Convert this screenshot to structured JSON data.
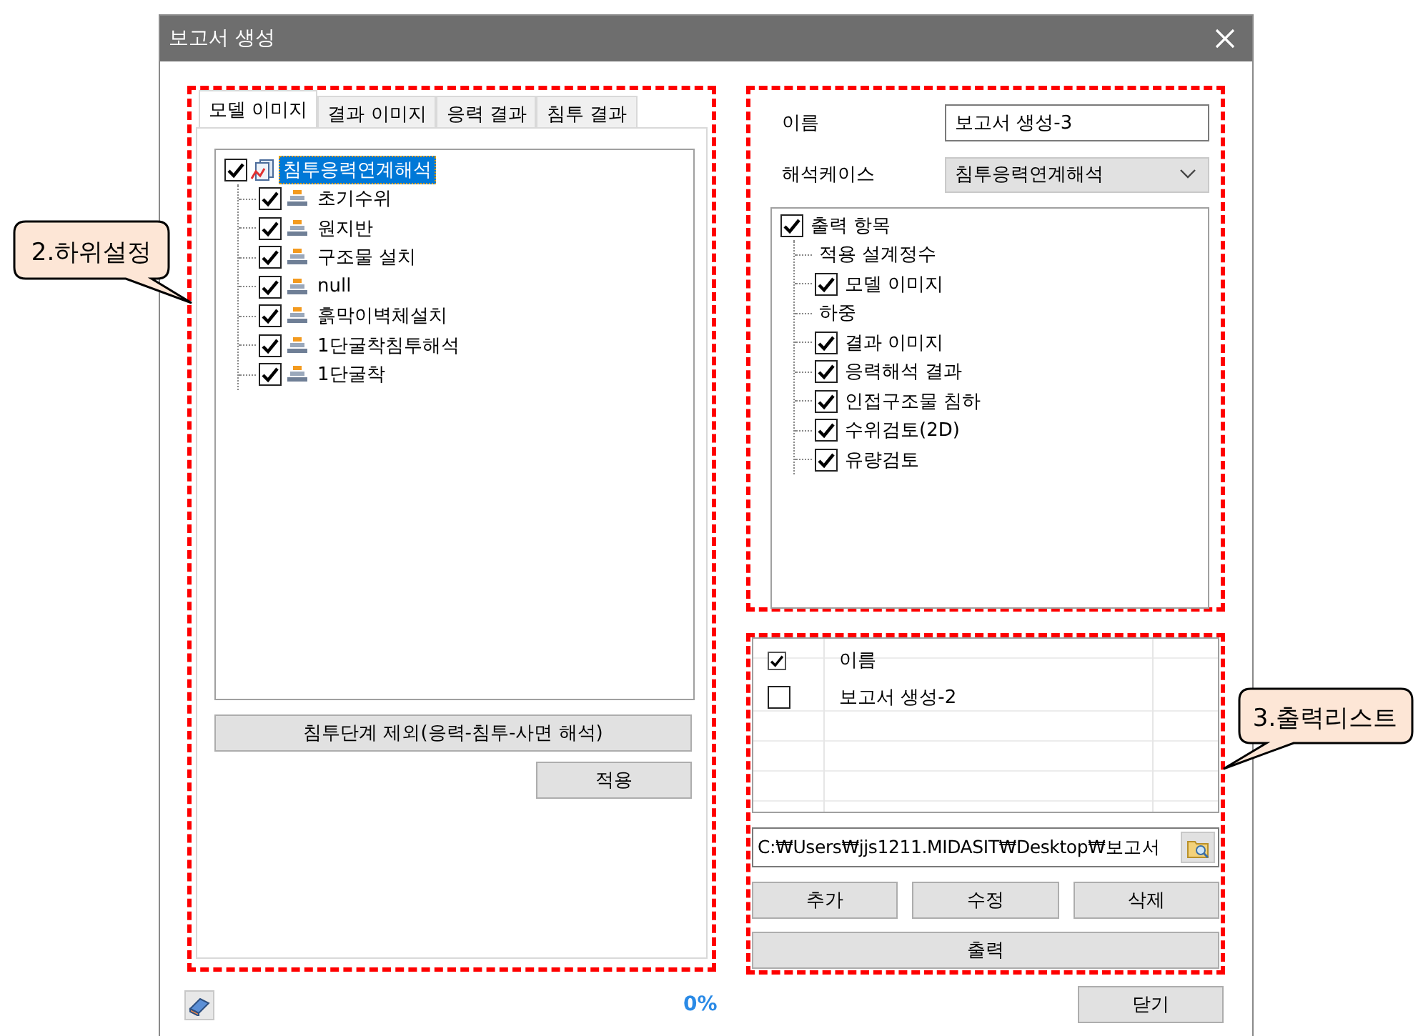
{
  "window": {
    "title": "보고서 생성"
  },
  "tabs": [
    {
      "label": "모델 이미지",
      "selected": true
    },
    {
      "label": "결과 이미지",
      "selected": false
    },
    {
      "label": "응력 결과",
      "selected": false
    },
    {
      "label": "침투 결과",
      "selected": false
    }
  ],
  "model_tree": {
    "label": "침투응력연계해석",
    "checked": true,
    "selected": true,
    "children": [
      {
        "label": "초기수위",
        "checked": true,
        "selected": false
      },
      {
        "label": "원지반",
        "checked": true,
        "selected": false
      },
      {
        "label": "구조물 설치",
        "checked": true,
        "selected": false
      },
      {
        "label": "null",
        "checked": true,
        "selected": false
      },
      {
        "label": "흙막이벽체설치",
        "checked": true,
        "selected": false
      },
      {
        "label": "1단굴착침투해석",
        "checked": true,
        "selected": false
      },
      {
        "label": "1단굴착",
        "checked": true,
        "selected": false
      }
    ]
  },
  "exclude_button": "침투단계 제외(응력-침투-사면 해석)",
  "apply_button": "적용",
  "name_field": {
    "label": "이름",
    "value": "보고서 생성-3"
  },
  "case_select": {
    "label": "해석케이스",
    "value": "침투응력연계해석"
  },
  "output_tree": {
    "label": "출력 항목",
    "checked": true,
    "children": [
      {
        "kind": "label",
        "label": "적용 설계정수"
      },
      {
        "kind": "checkbox",
        "label": "모델 이미지",
        "checked": true
      },
      {
        "kind": "label",
        "label": "하중"
      },
      {
        "kind": "checkbox",
        "label": "결과 이미지",
        "checked": true
      },
      {
        "kind": "checkbox",
        "label": "응력해석 결과",
        "checked": true
      },
      {
        "kind": "checkbox",
        "label": "인접구조물 침하",
        "checked": true
      },
      {
        "kind": "checkbox",
        "label": "수위검토(2D)",
        "checked": true
      },
      {
        "kind": "checkbox",
        "label": "유량검토",
        "checked": true
      }
    ]
  },
  "report_list": {
    "header_checked": true,
    "columns": [
      "이름"
    ],
    "rows": [
      {
        "checked": false,
        "name": "보고서 생성-2"
      }
    ]
  },
  "path_field": {
    "value": "C:₩Users₩jjs1211.MIDASIT₩Desktop₩보고서"
  },
  "action_buttons": [
    "추가",
    "수정",
    "삭제"
  ],
  "print_button": "출력",
  "progress": "0%",
  "close_button": "닫기",
  "callouts": [
    {
      "text": "2.하위설정"
    },
    {
      "text": "3.출력리스트"
    }
  ]
}
